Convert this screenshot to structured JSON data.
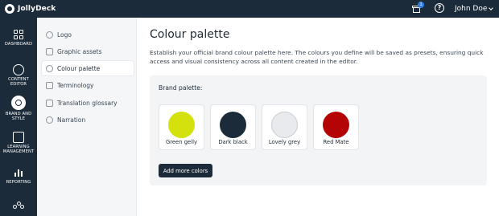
{
  "app": {
    "name": "JollyDeck"
  },
  "topbar": {
    "notification_count": "1",
    "help_label": "?",
    "user_name": "John Doe"
  },
  "nav": {
    "items": [
      {
        "label": "DASHBOARD",
        "icon": "dashboard-icon"
      },
      {
        "label": "CONTENT EDITOR",
        "icon": "content-editor-icon"
      },
      {
        "label": "BRAND AND STYLE",
        "icon": "brand-style-icon",
        "active": true
      },
      {
        "label": "LEARNING MANAGEMENT",
        "icon": "learning-management-icon"
      },
      {
        "label": "REPORTING",
        "icon": "reporting-icon"
      },
      {
        "label": "",
        "icon": "people-icon"
      }
    ]
  },
  "subnav": {
    "items": [
      {
        "label": "Logo"
      },
      {
        "label": "Graphic assets"
      },
      {
        "label": "Colour palette",
        "active": true
      },
      {
        "label": "Terminology"
      },
      {
        "label": "Translation glossary"
      },
      {
        "label": "Narration"
      }
    ]
  },
  "main": {
    "title": "Colour palette",
    "description": "Establish your official brand colour palette here. The colours you define will be saved as presets, ensuring quick access and visual consistency across all content created in the editor.",
    "panel_label": "Brand palette:",
    "swatches": [
      {
        "name": "Green gelly",
        "color": "#d4e10c"
      },
      {
        "name": "Dark black",
        "color": "#1c2b3a"
      },
      {
        "name": "Lovely grey",
        "color": "#e8eaed"
      },
      {
        "name": "Red Mate",
        "color": "#b50406"
      }
    ],
    "add_button_label": "Add more colors"
  }
}
